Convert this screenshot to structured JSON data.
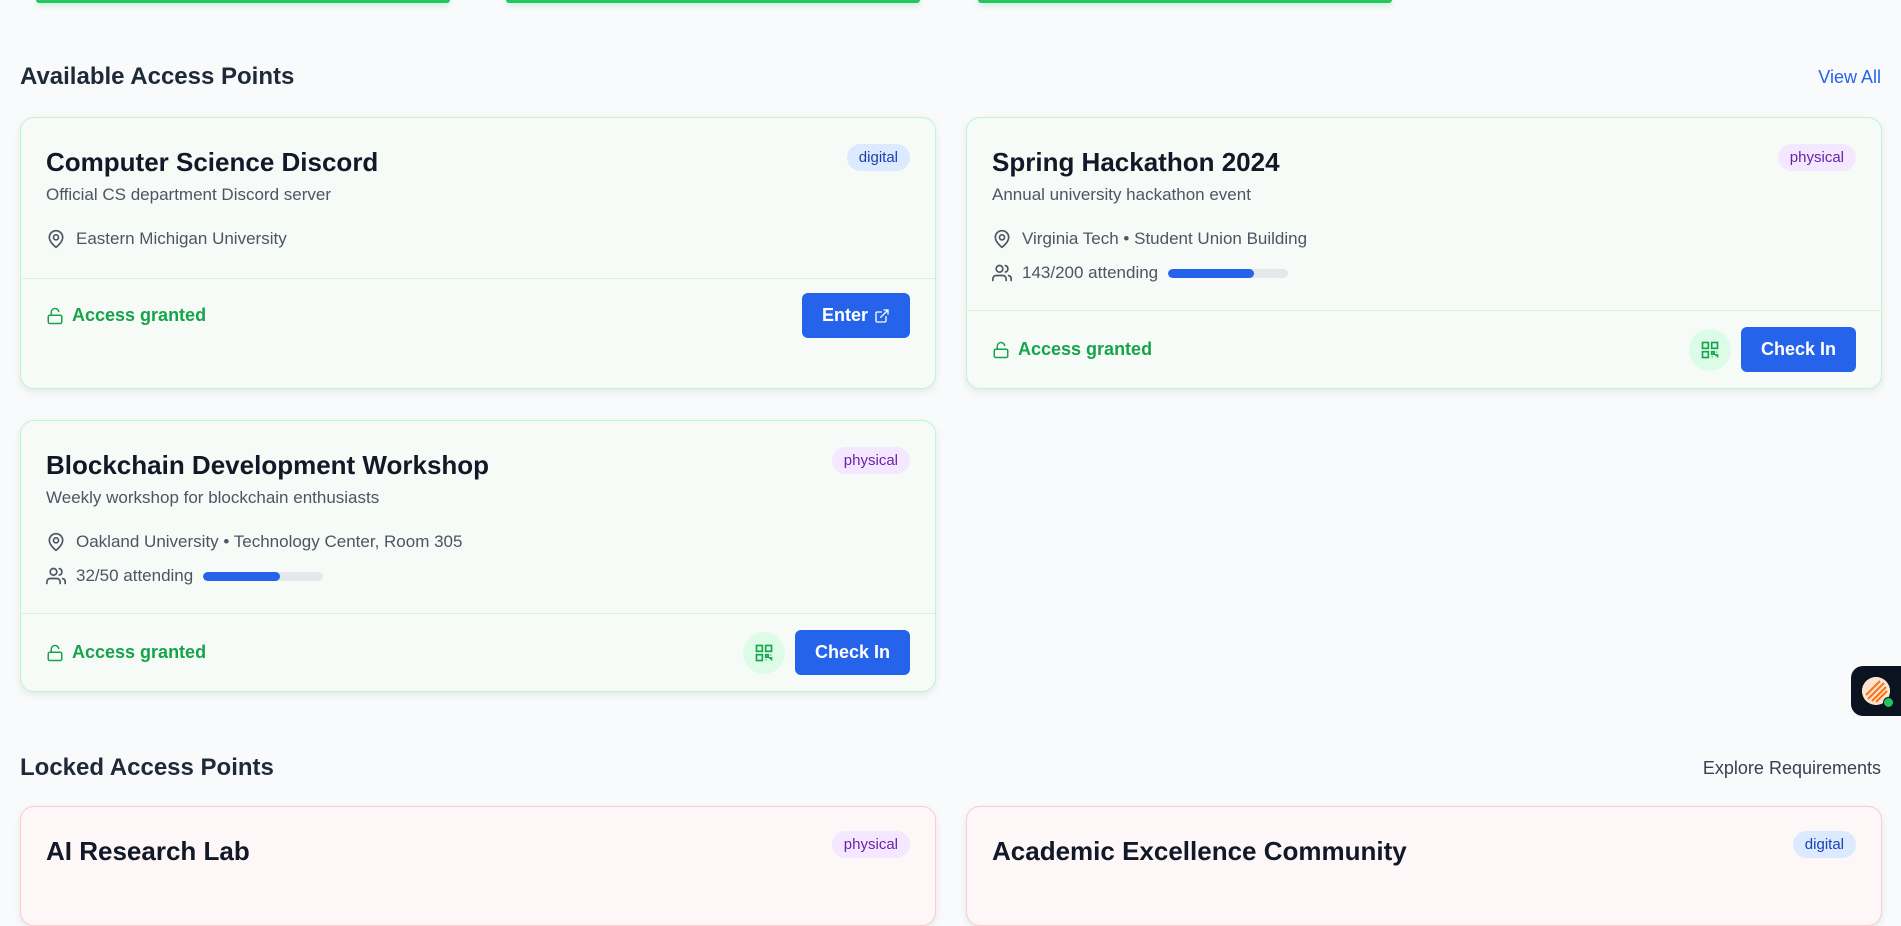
{
  "sections": {
    "available": {
      "title": "Available Access Points",
      "link": "View All"
    },
    "locked": {
      "title": "Locked Access Points",
      "link": "Explore Requirements"
    }
  },
  "available_cards": [
    {
      "title": "Computer Science Discord",
      "description": "Official CS department Discord server",
      "badge": "digital",
      "location": "Eastern Michigan University",
      "access": "Access granted",
      "action": "Enter"
    },
    {
      "title": "Spring Hackathon 2024",
      "description": "Annual university hackathon event",
      "badge": "physical",
      "location": "Virginia Tech • Student Union Building",
      "attendance": "143/200 attending",
      "attendance_fraction": 0.715,
      "access": "Access granted",
      "action": "Check In"
    },
    {
      "title": "Blockchain Development Workshop",
      "description": "Weekly workshop for blockchain enthusiasts",
      "badge": "physical",
      "location": "Oakland University • Technology Center, Room 305",
      "attendance": "32/50 attending",
      "attendance_fraction": 0.64,
      "access": "Access granted",
      "action": "Check In"
    }
  ],
  "locked_cards": [
    {
      "title": "AI Research Lab",
      "badge": "physical"
    },
    {
      "title": "Academic Excellence Community",
      "badge": "digital"
    }
  ],
  "colors": {
    "accent": "#2563eb",
    "granted": "#16a34a",
    "card_border": "#bbf7d0",
    "locked_border": "#fecaca"
  }
}
